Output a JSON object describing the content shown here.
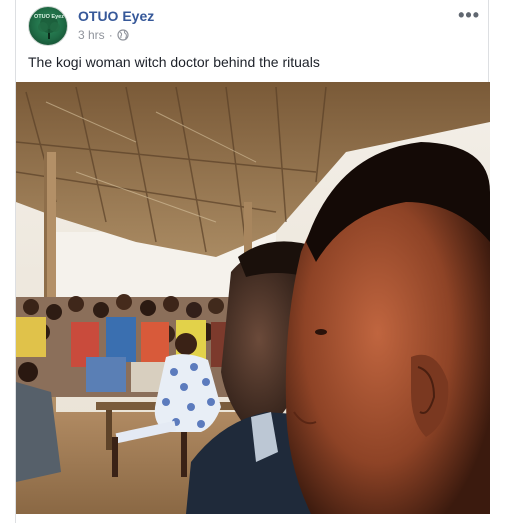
{
  "post": {
    "author": "OTUO Eyez",
    "avatar_text": "OTUO Eyez",
    "time": "3 hrs",
    "separator": "·",
    "privacy_icon": "globe-icon",
    "more_icon": "more-options-icon",
    "more_label": "•••",
    "caption": "The kogi woman witch doctor behind the rituals"
  },
  "colors": {
    "author_link": "#365899",
    "meta_text": "#90949c",
    "body_text": "#1d2129",
    "border": "#dddfe2"
  }
}
